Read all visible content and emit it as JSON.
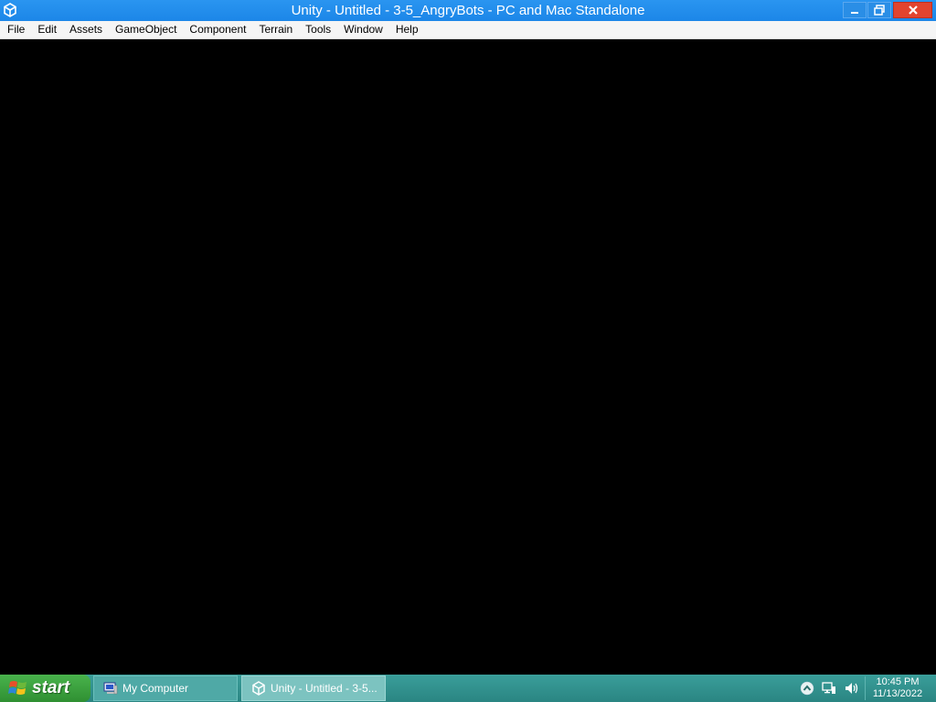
{
  "window": {
    "title": "Unity - Untitled - 3-5_AngryBots - PC and Mac Standalone",
    "titlebar_color": "#1e88e5",
    "close_color": "#e2442f"
  },
  "menubar": {
    "items": [
      "File",
      "Edit",
      "Assets",
      "GameObject",
      "Component",
      "Terrain",
      "Tools",
      "Window",
      "Help"
    ]
  },
  "taskbar": {
    "start_label": "start",
    "tasks": [
      {
        "label": "My Computer",
        "icon": "computer-icon"
      },
      {
        "label": "Unity - Untitled - 3-5...",
        "icon": "unity-icon"
      }
    ],
    "tray_icons": [
      "show-hidden-icons-arrow",
      "network-icon",
      "volume-icon"
    ],
    "clock": {
      "time": "10:45 PM",
      "date": "11/13/2022"
    },
    "color": "#2e8c8a"
  }
}
